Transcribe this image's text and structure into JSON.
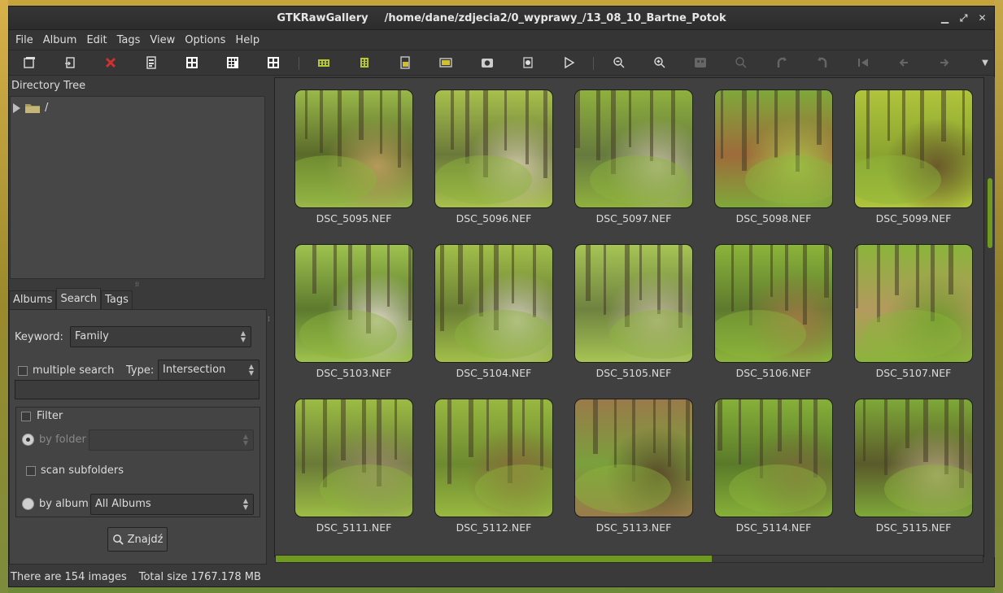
{
  "window": {
    "app_name": "GTKRawGallery",
    "path": "/home/dane/zdjecia2/0_wyprawy_/13_08_10_Bartne_Potok"
  },
  "menu": [
    "File",
    "Album",
    "Edit",
    "Tags",
    "View",
    "Options",
    "Help"
  ],
  "toolbar": {
    "icons": [
      "open-folder-icon",
      "export-icon",
      "delete-icon",
      "properties-icon",
      "grid-small-icon",
      "grid-medium-icon",
      "grid-large-icon",
      "view-1-icon",
      "view-2-icon",
      "view-3-icon",
      "view-4-icon",
      "camera-icon",
      "screenshot-icon",
      "play-icon",
      "zoom-out-icon",
      "zoom-in-icon",
      "fit-icon",
      "zoom-icon",
      "rotate-left-icon",
      "rotate-right-icon",
      "first-icon",
      "prev-icon",
      "next-icon"
    ]
  },
  "directory_tree": {
    "header": "Directory Tree",
    "root_label": "/"
  },
  "tabs": [
    "Albums",
    "Search",
    "Tags"
  ],
  "search": {
    "keyword_label": "Keyword:",
    "keyword_value": "Family",
    "multiple_search_label": "multiple search",
    "type_label": "Type:",
    "type_value": "Intersection",
    "filter_label": "Filter",
    "by_folder_label": "by folder",
    "scan_subfolders_label": "scan subfolders",
    "by_album_label": "by album",
    "album_value": "All Albums",
    "find_button": "Znajdź"
  },
  "thumbnails": [
    {
      "name": "DSC_5095.NEF",
      "c1": "#9ab84a",
      "c2": "#5a6a2a",
      "c3": "#b59a5a"
    },
    {
      "name": "DSC_5096.NEF",
      "c1": "#a8c04c",
      "c2": "#6b7a3a",
      "c3": "#c9c2a0"
    },
    {
      "name": "DSC_5097.NEF",
      "c1": "#8fb03e",
      "c2": "#667a3e",
      "c3": "#bdb89a"
    },
    {
      "name": "DSC_5098.NEF",
      "c1": "#7fa83a",
      "c2": "#9e6b3a",
      "c3": "#a9c24a"
    },
    {
      "name": "DSC_5099.NEF",
      "c1": "#b0c43c",
      "c2": "#8aa430",
      "c3": "#6a5a2a"
    },
    {
      "name": "DSC_5103.NEF",
      "c1": "#9ec24e",
      "c2": "#5d7a2e",
      "c3": "#d8d2c0"
    },
    {
      "name": "DSC_5104.NEF",
      "c1": "#a2bf4a",
      "c2": "#6a7e34",
      "c3": "#cfcab8"
    },
    {
      "name": "DSC_5105.NEF",
      "c1": "#a6c454",
      "c2": "#6f8240",
      "c3": "#bfb79a"
    },
    {
      "name": "DSC_5106.NEF",
      "c1": "#8bb43a",
      "c2": "#5e7a2e",
      "c3": "#9c7a44"
    },
    {
      "name": "DSC_5107.NEF",
      "c1": "#8ab43a",
      "c2": "#b39a5e",
      "c3": "#6f9a2c"
    },
    {
      "name": "DSC_5111.NEF",
      "c1": "#9cbc44",
      "c2": "#6a7a38",
      "c3": "#9a8a6a"
    },
    {
      "name": "DSC_5112.NEF",
      "c1": "#98b840",
      "c2": "#6e8a30",
      "c3": "#8a6a3a"
    },
    {
      "name": "DSC_5113.NEF",
      "c1": "#9a7a4a",
      "c2": "#7aa03c",
      "c3": "#5a4a2a"
    },
    {
      "name": "DSC_5114.NEF",
      "c1": "#86b038",
      "c2": "#5a7a2a",
      "c3": "#7a6a3a"
    },
    {
      "name": "DSC_5115.NEF",
      "c1": "#7ea838",
      "c2": "#5a5a2a",
      "c3": "#b0a27a"
    }
  ],
  "progress_fraction": 0.617,
  "scroll_fraction": 0.21,
  "status": {
    "image_count": "There are 154 images",
    "total_size": "Total size 1767.178 MB"
  },
  "colors": {
    "accent": "#6f9a1f",
    "window_bg": "#3a3a3a"
  }
}
